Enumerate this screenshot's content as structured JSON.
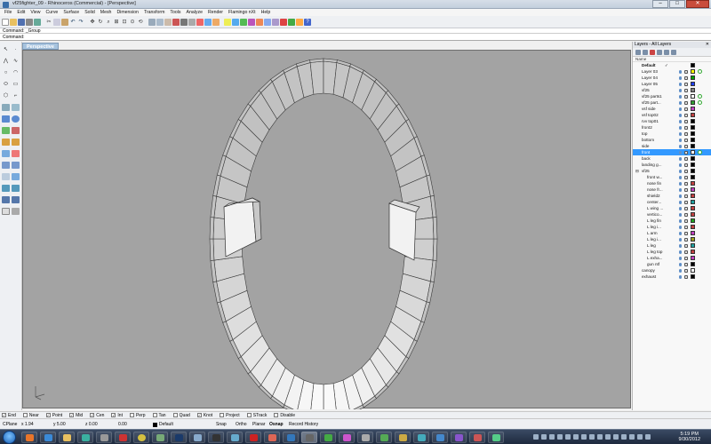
{
  "window": {
    "title": "vf25fighter_09 - Rhinoceros (Commercial) - [Perspective]"
  },
  "menu": [
    "File",
    "Edit",
    "View",
    "Curve",
    "Surface",
    "Solid",
    "Mesh",
    "Dimension",
    "Transform",
    "Tools",
    "Analyze",
    "Render",
    "Flamingo nXt",
    "Help"
  ],
  "command": {
    "history": "Command: _Group",
    "prompt": "Command:"
  },
  "viewport": {
    "label": "Perspective"
  },
  "layers_panel": {
    "title": "Layers - All Layers",
    "column_name": "Name",
    "rows": [
      {
        "name": "Default",
        "color": "#000000",
        "current": "✓",
        "bold": true
      },
      {
        "name": "Layer 03",
        "color": "#ffff00",
        "indent": 0
      },
      {
        "name": "Layer 04",
        "color": "#00a000"
      },
      {
        "name": "Layer 05",
        "color": "#2040ff"
      },
      {
        "name": "vf25",
        "color": "#808080"
      },
      {
        "name": "vf25 parts1",
        "color": "#ffffff"
      },
      {
        "name": "vf25 part...",
        "color": "#30a030"
      },
      {
        "name": "vsf side",
        "color": "#c040c0"
      },
      {
        "name": "vsf top02",
        "color": "#c04040"
      },
      {
        "name": "rvv top01",
        "color": "#000000"
      },
      {
        "name": "front2",
        "color": "#000000"
      },
      {
        "name": "top",
        "color": "#000000"
      },
      {
        "name": "bottom",
        "color": "#000000"
      },
      {
        "name": "side",
        "color": "#000000"
      },
      {
        "name": "front",
        "color": "#ffffff",
        "selected": true
      },
      {
        "name": "back",
        "color": "#000000"
      },
      {
        "name": "landing g...",
        "color": "#000000"
      },
      {
        "name": "vf25",
        "color": "#000000",
        "tree": "⊟"
      },
      {
        "name": "front w...",
        "color": "#000000",
        "sub": true
      },
      {
        "name": "nose fin",
        "color": "#c04040",
        "sub": true
      },
      {
        "name": "nose fr...",
        "color": "#c040c0",
        "sub": true
      },
      {
        "name": "shield2",
        "color": "#c04040",
        "sub": true
      },
      {
        "name": "center...",
        "color": "#20a0a0",
        "sub": true
      },
      {
        "name": "L wing ...",
        "color": "#c04040",
        "sub": true
      },
      {
        "name": "vertico...",
        "color": "#c04040",
        "sub": true
      },
      {
        "name": "L leg fin",
        "color": "#20a020",
        "sub": true
      },
      {
        "name": "L leg i...",
        "color": "#c04040",
        "sub": true
      },
      {
        "name": "L arm",
        "color": "#c040c0",
        "sub": true
      },
      {
        "name": "L leg i...",
        "color": "#a0a020",
        "sub": true
      },
      {
        "name": "L leg",
        "color": "#20a0a0",
        "sub": true
      },
      {
        "name": "L leg top",
        "color": "#c04040",
        "sub": true
      },
      {
        "name": "L exha...",
        "color": "#c040c0",
        "sub": true
      },
      {
        "name": "gun ntf",
        "color": "#000000",
        "sub": true
      },
      {
        "name": "canopy",
        "color": "#ffffff"
      },
      {
        "name": "exhaust",
        "color": "#000000"
      }
    ]
  },
  "osnap": [
    "End",
    "Near",
    "Point",
    "Mid",
    "Cen",
    "Int",
    "Perp",
    "Tan",
    "Quad",
    "Knot",
    "Project",
    "STrack",
    "Disable"
  ],
  "osnap_checked": [
    true,
    false,
    true,
    true,
    true,
    true,
    false,
    false,
    false,
    true,
    false,
    false,
    false
  ],
  "status": {
    "cplane": "CPlane",
    "x": "x 1.94",
    "y": "y 5.00",
    "z": "z 0.00",
    "units": "0.00",
    "layer": "Default",
    "snap": "Snap",
    "ortho": "Ortho",
    "planar": "Planar",
    "osnap": "Osnap",
    "record": "Record History"
  },
  "clock": {
    "time": "5:19 PM",
    "date": "9/30/2012"
  },
  "colors": {
    "viewport_bg": "#a3a3a3",
    "selected_layer": "#3399ff",
    "viewport_tab": "#a7c3de"
  }
}
